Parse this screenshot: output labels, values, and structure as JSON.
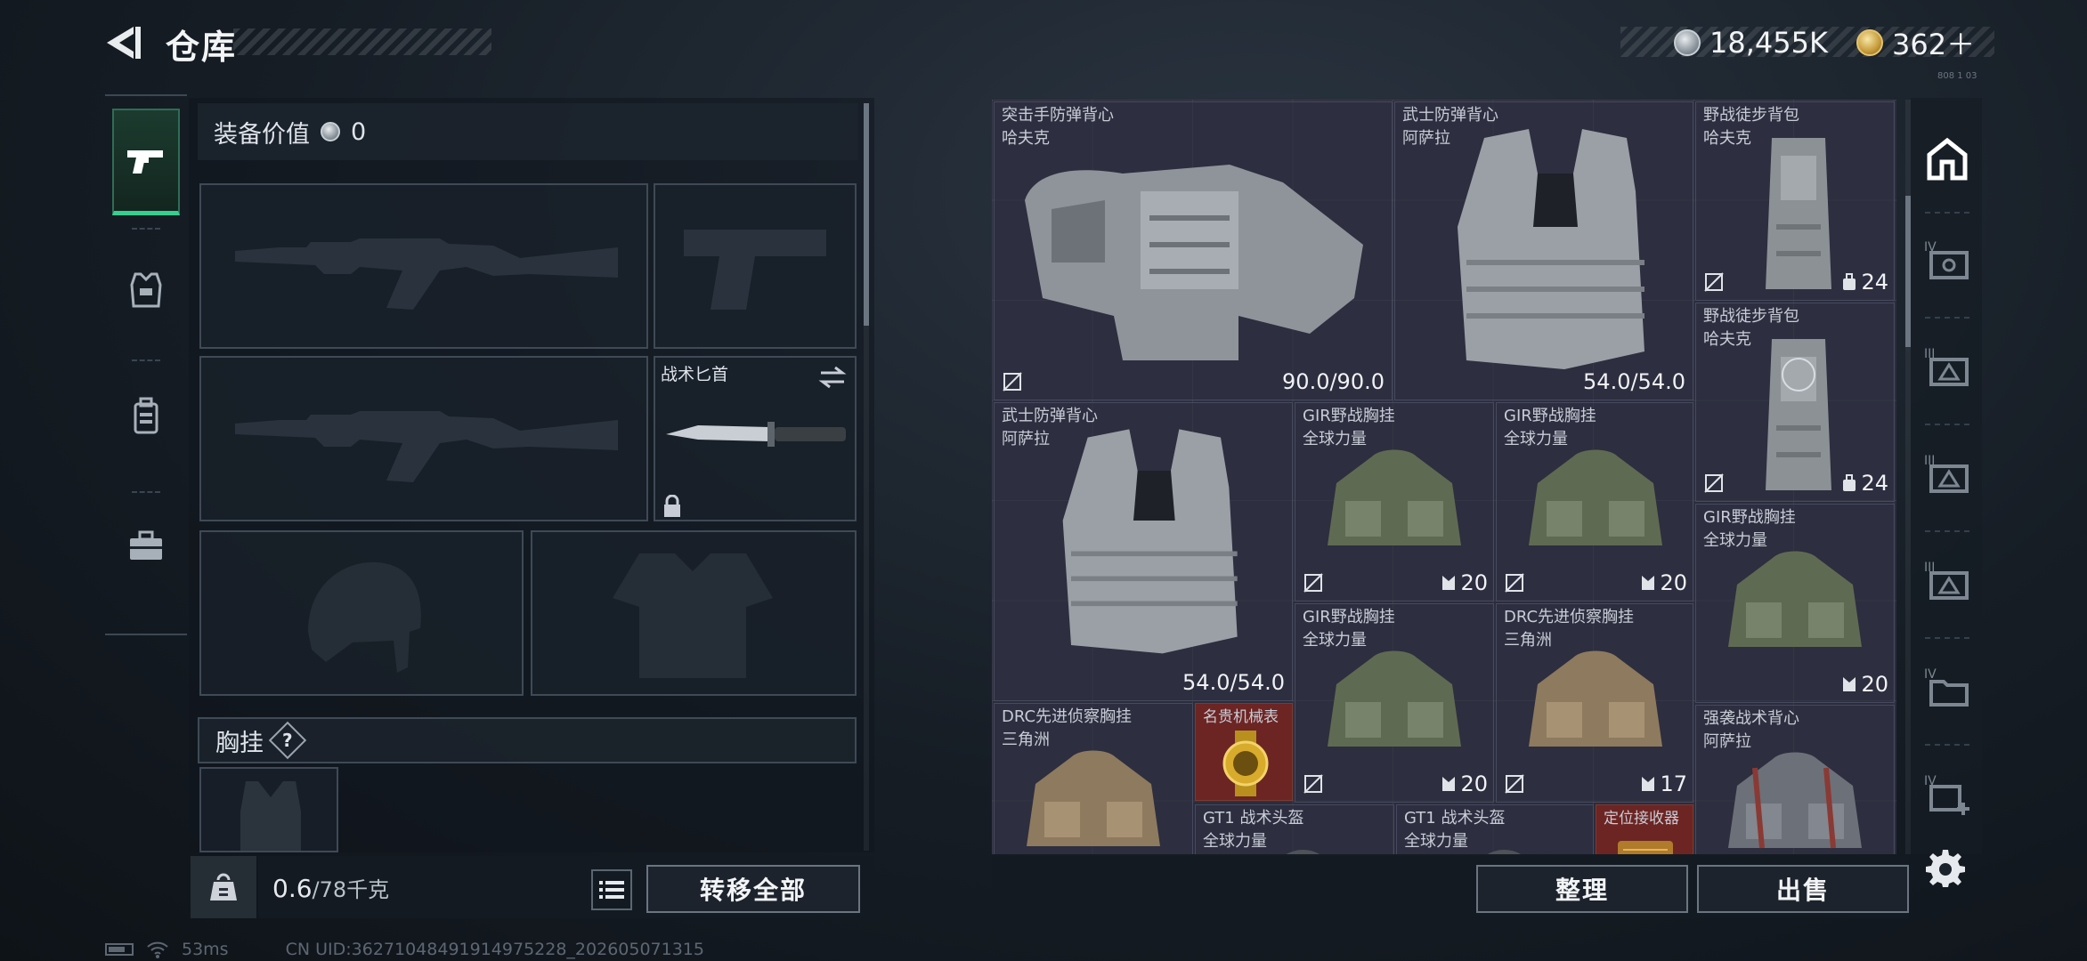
{
  "header": {
    "title": "仓库",
    "currencies": [
      {
        "icon": "silver-coin-icon",
        "value": "18,455K"
      },
      {
        "icon": "gold-coin-icon",
        "value": "362＋"
      }
    ],
    "corner_code": "808 1 03"
  },
  "left_tabs": [
    {
      "icon": "pistol-icon",
      "active": true
    },
    {
      "icon": "armor-vest-icon",
      "active": false
    },
    {
      "icon": "backpack-icon",
      "active": false
    },
    {
      "icon": "toolbox-icon",
      "active": false
    }
  ],
  "loadout": {
    "equip_value_label": "装备价值",
    "equip_value": "0",
    "slots": {
      "primary_1": {
        "icon": "assault-rifle-icon"
      },
      "pistol": {
        "icon": "pistol-icon"
      },
      "primary_2": {
        "icon": "assault-rifle-icon"
      },
      "melee": {
        "label": "战术匕首",
        "icon": "knife-icon",
        "locked": true
      },
      "helmet": {
        "icon": "helmet-icon"
      },
      "armor": {
        "icon": "armor-vest-icon"
      }
    },
    "chest_rig_label": "胸挂",
    "chest_rig_help": "?",
    "weight_current": "0.6",
    "weight_max_unit": "/78千克",
    "transfer_all_label": "转移全部"
  },
  "storage": {
    "items": [
      {
        "name": "突击手防弹背心",
        "brand": "哈夫克",
        "durability": "90.0/90.0",
        "icon": "armor-vest-icon"
      },
      {
        "name": "武士防弹背心",
        "brand": "阿萨拉",
        "durability": "54.0/54.0",
        "icon": "armor-vest-icon"
      },
      {
        "name": "野战徒步背包",
        "brand": "哈夫克",
        "capacity": "24",
        "icon": "backpack-icon"
      },
      {
        "name": "野战徒步背包",
        "brand": "哈夫克",
        "capacity": "24",
        "icon": "backpack-icon"
      },
      {
        "name": "武士防弹背心",
        "brand": "阿萨拉",
        "durability": "54.0/54.0",
        "icon": "armor-vest-icon"
      },
      {
        "name": "GIR野战胸挂",
        "brand": "全球力量",
        "capacity": "20",
        "icon": "chest-rig-icon"
      },
      {
        "name": "GIR野战胸挂",
        "brand": "全球力量",
        "capacity": "20",
        "icon": "chest-rig-icon"
      },
      {
        "name": "GIR野战胸挂",
        "brand": "全球力量",
        "capacity": "20",
        "icon": "chest-rig-icon"
      },
      {
        "name": "GIR野战胸挂",
        "brand": "全球力量",
        "capacity": "20",
        "icon": "chest-rig-icon"
      },
      {
        "name": "DRC先进侦察胸挂",
        "brand": "三角洲",
        "capacity": "17",
        "icon": "chest-rig-icon"
      },
      {
        "name": "DRC先进侦察胸挂",
        "brand": "三角洲",
        "icon": "chest-rig-icon"
      },
      {
        "name": "名贵机械表",
        "icon": "watch-icon"
      },
      {
        "name": "强袭战术背心",
        "brand": "阿萨拉",
        "icon": "chest-rig-icon"
      },
      {
        "name": "GT1 战术头盔",
        "brand": "全球力量",
        "icon": "helmet-icon"
      },
      {
        "name": "GT1 战术头盔",
        "brand": "全球力量",
        "icon": "helmet-icon"
      },
      {
        "name": "定位接收器",
        "icon": "receiver-icon"
      }
    ],
    "sort_label": "整理",
    "sell_label": "出售"
  },
  "right_tabs": [
    {
      "icon": "home-storage-icon",
      "active": true
    },
    {
      "icon": "storage-tier-4-icon",
      "active": false
    },
    {
      "icon": "storage-tier-3a-icon",
      "active": false
    },
    {
      "icon": "storage-tier-3b-icon",
      "active": false
    },
    {
      "icon": "storage-tier-3c-icon",
      "active": false
    },
    {
      "icon": "storage-tier-4-folder-icon",
      "active": false
    },
    {
      "icon": "storage-tier-4-add-icon",
      "active": false
    }
  ],
  "status": {
    "ping": "53ms",
    "uid": "CN UID:3627104849191497522​8_202605071315"
  },
  "colors": {
    "accent_green": "#34d08f",
    "item_bg": "#2b2c3c",
    "rare_red": "#7c3a30"
  }
}
